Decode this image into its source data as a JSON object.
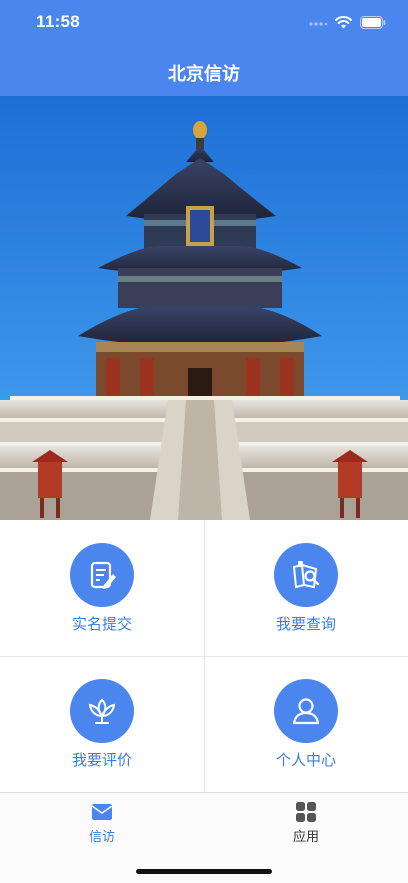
{
  "status_bar": {
    "time": "11:58",
    "icons": [
      "signal-icon",
      "wifi-icon",
      "battery-icon"
    ]
  },
  "header": {
    "title": "北京信访"
  },
  "hero": {
    "subject": "temple-of-heaven-photo"
  },
  "menu": {
    "items": [
      {
        "label": "实名提交",
        "icon": "edit-document-icon"
      },
      {
        "label": "我要查询",
        "icon": "search-folder-icon"
      },
      {
        "label": "我要评价",
        "icon": "lotus-icon"
      },
      {
        "label": "个人中心",
        "icon": "user-icon"
      }
    ]
  },
  "tabbar": {
    "tabs": [
      {
        "label": "信访",
        "icon": "envelope-icon",
        "active": true
      },
      {
        "label": "应用",
        "icon": "grid-icon",
        "active": false
      }
    ]
  },
  "colors": {
    "primary": "#4b86ee",
    "active_text": "#3b7de0",
    "inactive_text": "#333333"
  }
}
